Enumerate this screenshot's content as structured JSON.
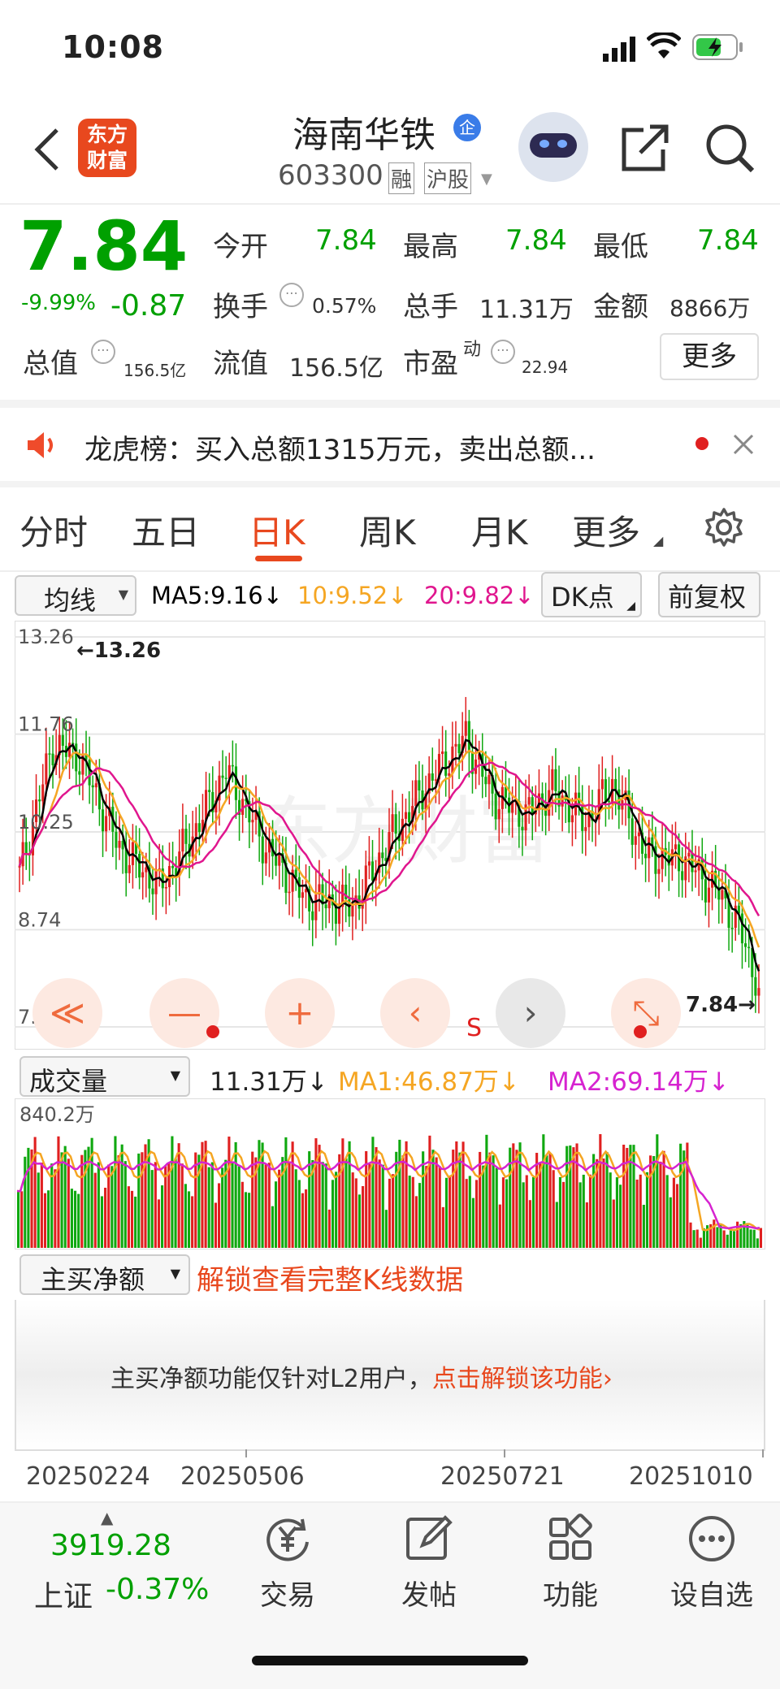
{
  "status_bar": {
    "time": "10:08"
  },
  "header": {
    "logo_line1": "东方",
    "logo_line2": "财富",
    "stock_name": "海南华铁",
    "ent_badge": "企",
    "stock_code": "603300",
    "tag1": "融",
    "tag2": "沪股"
  },
  "quote": {
    "price": "7.84",
    "change_pct": "-9.99%",
    "change_amt": "-0.87",
    "open_label": "今开",
    "open": "7.84",
    "high_label": "最高",
    "high": "7.84",
    "low_label": "最低",
    "low": "7.84",
    "turnover_label": "换手",
    "turnover": "0.57%",
    "volume_label": "总手",
    "volume": "11.31万",
    "amount_label": "金额",
    "amount": "8866万",
    "mktcap_label": "总值",
    "mktcap": "156.5亿",
    "float_label": "流值",
    "float": "156.5亿",
    "pe_label": "市盈",
    "pe_sup": "动",
    "pe": "22.94",
    "more_button": "更多"
  },
  "notice": {
    "text": "龙虎榜：买入总额1315万元，卖出总额..."
  },
  "tabs": [
    "分时",
    "五日",
    "日K",
    "周K",
    "月K",
    "更多"
  ],
  "active_tab_index": 2,
  "kline": {
    "indicator_select": "均线",
    "ma5": "MA5:9.16↓",
    "ma10": "10:9.52↓",
    "ma20": "20:9.82↓",
    "dk_button": "DK点",
    "adjust_button": "前复权",
    "y_labels": [
      "13.26",
      "11.76",
      "10.25",
      "8.74",
      "7.24"
    ],
    "max_marker": "13.26",
    "last_marker": "7.84",
    "s_marker": "S",
    "colors": {
      "ma5": "#000000",
      "ma10": "#f5a623",
      "ma20": "#e0168e",
      "up": "#e02020",
      "down": "#10a810"
    }
  },
  "controls": {
    "rewind": "≪",
    "zoom_out": "—",
    "zoom_in": "+",
    "prev": "‹",
    "next": "›",
    "expand": "⤡"
  },
  "volume_panel": {
    "select": "成交量",
    "current": "11.31万↓",
    "ma1": "MA1:46.87万↓",
    "ma2": "MA2:69.14万↓",
    "max_label": "840.2万"
  },
  "net_panel": {
    "select": "主买净额",
    "unlock_link": "解锁查看完整K线数据",
    "message": "主买净额功能仅针对L2用户，",
    "message_link": "点击解锁该功能"
  },
  "dates": [
    "20250224",
    "20250506",
    "20250721",
    "20251010"
  ],
  "bottom_nav": {
    "index_value": "3919.28",
    "index_name": "上证",
    "index_change": "-0.37%",
    "items": [
      "交易",
      "发帖",
      "功能",
      "设自选"
    ]
  }
}
